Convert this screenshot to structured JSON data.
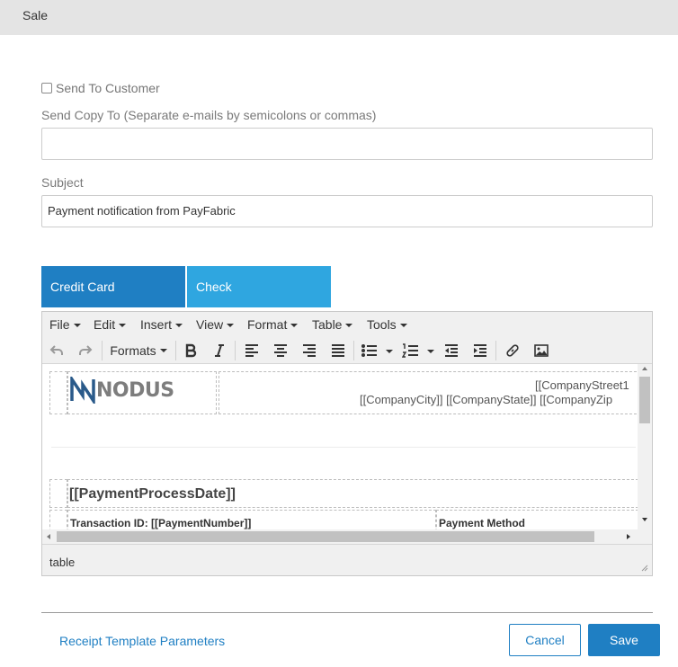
{
  "header": {
    "title": "Sale"
  },
  "form": {
    "send_to_customer_label": "Send To Customer",
    "send_copy_label": "Send Copy To (Separate e-mails by semicolons or commas)",
    "send_copy_value": "",
    "subject_label": "Subject",
    "subject_value": "Payment notification from PayFabric"
  },
  "tabs": [
    {
      "label": "Credit Card",
      "active": true
    },
    {
      "label": "Check",
      "active": false
    }
  ],
  "editor": {
    "menus": [
      "File",
      "Edit",
      "Insert",
      "View",
      "Format",
      "Table",
      "Tools"
    ],
    "formats_label": "Formats",
    "content": {
      "logo_text": "NODUS",
      "address_line1": "[[CompanyStreet1",
      "address_line2": "[[CompanyCity]] [[CompanyState]] [[CompanyZip",
      "payment_date": "[[PaymentProcessDate]]",
      "transaction_id": "Transaction ID: [[PaymentNumber]]",
      "payment_method": "Payment Method"
    },
    "status_path": "table"
  },
  "footer": {
    "template_link": "Receipt Template Parameters",
    "cancel_label": "Cancel",
    "save_label": "Save"
  },
  "colors": {
    "primary": "#1f7fc3",
    "tab_inactive": "#2fa6e0",
    "header_bg": "#e4e4e4"
  }
}
